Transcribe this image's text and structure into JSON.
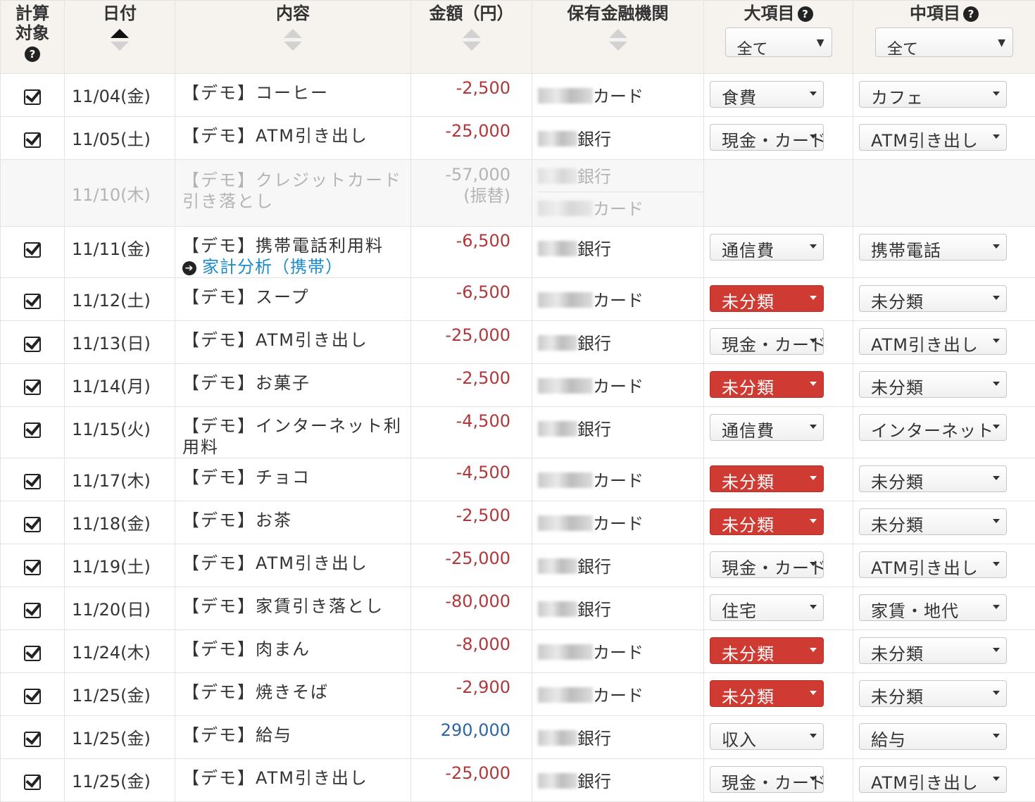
{
  "header": {
    "target": "計算対象",
    "date": "日付",
    "content": "内容",
    "amount": "金額（円）",
    "institution": "保有金融機関",
    "large_category": "大項目",
    "mid_category": "中項目",
    "large_filter": "全て",
    "mid_filter": "全て",
    "help_glyph": "?"
  },
  "transfer": {
    "date": "11/10(木)",
    "desc": "【デモ】クレジットカード引き落とし",
    "amount": "-57,000",
    "amount_note": "(振替)",
    "inst_from": "銀行",
    "inst_to": "カード"
  },
  "link_glyph": "➔",
  "rows": [
    {
      "date": "11/04(金)",
      "desc": "【デモ】コーヒー",
      "link": "",
      "amount": "-2,500",
      "sign": "neg",
      "inst": "カード",
      "inst_type": "card",
      "large": "食費",
      "large_red": false,
      "mid": "カフェ"
    },
    {
      "date": "11/05(土)",
      "desc": "【デモ】ATM引き出し",
      "link": "",
      "amount": "-25,000",
      "sign": "neg",
      "inst": "銀行",
      "inst_type": "bank",
      "large": "現金・カード",
      "large_red": false,
      "mid": "ATM引き出し"
    },
    {
      "date": "11/11(金)",
      "desc": "【デモ】携帯電話利用料",
      "link": "家計分析（携帯）",
      "amount": "-6,500",
      "sign": "neg",
      "inst": "銀行",
      "inst_type": "bank",
      "large": "通信費",
      "large_red": false,
      "mid": "携帯電話"
    },
    {
      "date": "11/12(土)",
      "desc": "【デモ】スープ",
      "link": "",
      "amount": "-6,500",
      "sign": "neg",
      "inst": "カード",
      "inst_type": "card",
      "large": "未分類",
      "large_red": true,
      "mid": "未分類"
    },
    {
      "date": "11/13(日)",
      "desc": "【デモ】ATM引き出し",
      "link": "",
      "amount": "-25,000",
      "sign": "neg",
      "inst": "銀行",
      "inst_type": "bank",
      "large": "現金・カード",
      "large_red": false,
      "mid": "ATM引き出し"
    },
    {
      "date": "11/14(月)",
      "desc": "【デモ】お菓子",
      "link": "",
      "amount": "-2,500",
      "sign": "neg",
      "inst": "カード",
      "inst_type": "card",
      "large": "未分類",
      "large_red": true,
      "mid": "未分類"
    },
    {
      "date": "11/15(火)",
      "desc": "【デモ】インターネット利用料",
      "link": "",
      "amount": "-4,500",
      "sign": "neg",
      "inst": "銀行",
      "inst_type": "bank",
      "large": "通信費",
      "large_red": false,
      "mid": "インターネット"
    },
    {
      "date": "11/17(木)",
      "desc": "【デモ】チョコ",
      "link": "",
      "amount": "-4,500",
      "sign": "neg",
      "inst": "カード",
      "inst_type": "card",
      "large": "未分類",
      "large_red": true,
      "mid": "未分類"
    },
    {
      "date": "11/18(金)",
      "desc": "【デモ】お茶",
      "link": "",
      "amount": "-2,500",
      "sign": "neg",
      "inst": "カード",
      "inst_type": "card",
      "large": "未分類",
      "large_red": true,
      "mid": "未分類"
    },
    {
      "date": "11/19(土)",
      "desc": "【デモ】ATM引き出し",
      "link": "",
      "amount": "-25,000",
      "sign": "neg",
      "inst": "銀行",
      "inst_type": "bank",
      "large": "現金・カード",
      "large_red": false,
      "mid": "ATM引き出し"
    },
    {
      "date": "11/20(日)",
      "desc": "【デモ】家賃引き落とし",
      "link": "",
      "amount": "-80,000",
      "sign": "neg",
      "inst": "銀行",
      "inst_type": "bank",
      "large": "住宅",
      "large_red": false,
      "mid": "家賃・地代"
    },
    {
      "date": "11/24(木)",
      "desc": "【デモ】肉まん",
      "link": "",
      "amount": "-8,000",
      "sign": "neg",
      "inst": "カード",
      "inst_type": "card",
      "large": "未分類",
      "large_red": true,
      "mid": "未分類"
    },
    {
      "date": "11/25(金)",
      "desc": "【デモ】焼きそば",
      "link": "",
      "amount": "-2,900",
      "sign": "neg",
      "inst": "カード",
      "inst_type": "card",
      "large": "未分類",
      "large_red": true,
      "mid": "未分類"
    },
    {
      "date": "11/25(金)",
      "desc": "【デモ】給与",
      "link": "",
      "amount": "290,000",
      "sign": "pos",
      "inst": "銀行",
      "inst_type": "bank",
      "large": "収入",
      "large_red": false,
      "mid": "給与"
    },
    {
      "date": "11/25(金)",
      "desc": "【デモ】ATM引き出し",
      "link": "",
      "amount": "-25,000",
      "sign": "neg",
      "inst": "銀行",
      "inst_type": "bank",
      "large": "現金・カード",
      "large_red": false,
      "mid": "ATM引き出し"
    }
  ]
}
